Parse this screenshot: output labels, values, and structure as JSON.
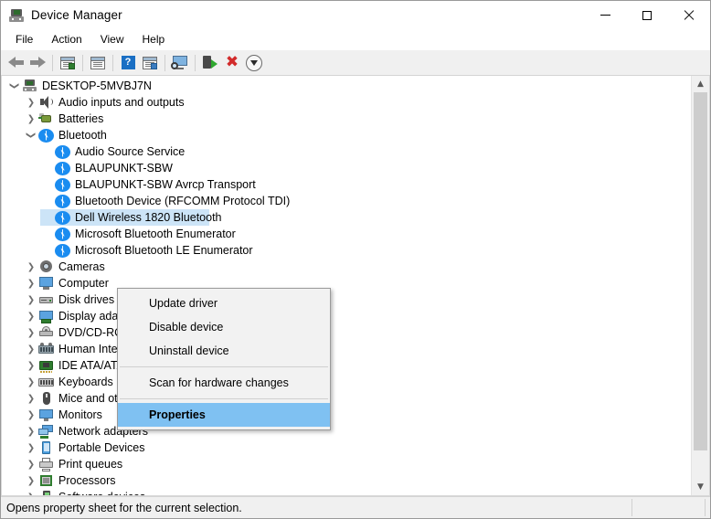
{
  "window": {
    "title": "Device Manager",
    "title_icon": "computer-icon",
    "buttons": {
      "minimize": "minimize-button",
      "maximize": "maximize-button",
      "close": "close-button"
    }
  },
  "menubar": [
    {
      "label": "File"
    },
    {
      "label": "Action"
    },
    {
      "label": "View"
    },
    {
      "label": "Help"
    }
  ],
  "toolbar": [
    {
      "name": "back-icon",
      "type": "arrow-left"
    },
    {
      "name": "forward-icon",
      "type": "arrow-right"
    },
    {
      "name": "separator-1",
      "type": "sep"
    },
    {
      "name": "show-hide-console-tree-icon",
      "type": "win-green"
    },
    {
      "name": "separator-2",
      "type": "sep"
    },
    {
      "name": "properties-icon",
      "type": "win-plain"
    },
    {
      "name": "separator-3",
      "type": "sep"
    },
    {
      "name": "help-icon",
      "type": "help"
    },
    {
      "name": "update-driver-icon",
      "type": "win-blue"
    },
    {
      "name": "separator-4",
      "type": "sep"
    },
    {
      "name": "scan-for-hardware-changes-icon",
      "type": "monitor"
    },
    {
      "name": "separator-5",
      "type": "sep"
    },
    {
      "name": "enable-device-icon",
      "type": "scan"
    },
    {
      "name": "uninstall-device-icon",
      "type": "x"
    },
    {
      "name": "update-driver-download-icon",
      "type": "down"
    }
  ],
  "tree": [
    {
      "label": "DESKTOP-5MVBJ7N",
      "indent": 0,
      "twisty": "expanded",
      "icon": "computer-icon"
    },
    {
      "label": "Audio inputs and outputs",
      "indent": 1,
      "twisty": "collapsed",
      "icon": "speaker-icon"
    },
    {
      "label": "Batteries",
      "indent": 1,
      "twisty": "collapsed",
      "icon": "battery-icon"
    },
    {
      "label": "Bluetooth",
      "indent": 1,
      "twisty": "expanded",
      "icon": "bluetooth-icon"
    },
    {
      "label": "Audio Source Service",
      "indent": 2,
      "twisty": "none",
      "icon": "bluetooth-icon"
    },
    {
      "label": "BLAUPUNKT-SBW",
      "indent": 2,
      "twisty": "none",
      "icon": "bluetooth-icon"
    },
    {
      "label": "BLAUPUNKT-SBW Avrcp Transport",
      "indent": 2,
      "twisty": "none",
      "icon": "bluetooth-icon"
    },
    {
      "label": "Bluetooth Device (RFCOMM Protocol TDI)",
      "indent": 2,
      "twisty": "none",
      "icon": "bluetooth-icon"
    },
    {
      "label": "Dell Wireless 1820 Bluetooth",
      "indent": 2,
      "twisty": "none",
      "icon": "bluetooth-icon",
      "selected": true,
      "clipped_width": 185
    },
    {
      "label": "Microsoft Bluetooth Enumerator",
      "indent": 2,
      "twisty": "none",
      "icon": "bluetooth-icon"
    },
    {
      "label": "Microsoft Bluetooth LE Enumerator",
      "indent": 2,
      "twisty": "none",
      "icon": "bluetooth-icon"
    },
    {
      "label": "Cameras",
      "indent": 1,
      "twisty": "collapsed",
      "icon": "camera-icon"
    },
    {
      "label": "Computer",
      "indent": 1,
      "twisty": "collapsed",
      "icon": "computer-monitor-icon"
    },
    {
      "label": "Disk drives",
      "indent": 1,
      "twisty": "collapsed",
      "icon": "disk-drive-icon"
    },
    {
      "label": "Display adapters",
      "indent": 1,
      "twisty": "collapsed",
      "icon": "display-adapter-icon"
    },
    {
      "label": "DVD/CD-ROM drives",
      "indent": 1,
      "twisty": "collapsed",
      "icon": "dvd-drive-icon"
    },
    {
      "label": "Human Interface Devices",
      "indent": 1,
      "twisty": "collapsed",
      "icon": "hid-icon"
    },
    {
      "label": "IDE ATA/ATAPI controllers",
      "indent": 1,
      "twisty": "collapsed",
      "icon": "ide-controller-icon"
    },
    {
      "label": "Keyboards",
      "indent": 1,
      "twisty": "collapsed",
      "icon": "keyboard-icon"
    },
    {
      "label": "Mice and other pointing devices",
      "indent": 1,
      "twisty": "collapsed",
      "icon": "mouse-icon"
    },
    {
      "label": "Monitors",
      "indent": 1,
      "twisty": "collapsed",
      "icon": "monitor-icon"
    },
    {
      "label": "Network adapters",
      "indent": 1,
      "twisty": "collapsed",
      "icon": "network-adapter-icon"
    },
    {
      "label": "Portable Devices",
      "indent": 1,
      "twisty": "collapsed",
      "icon": "portable-device-icon"
    },
    {
      "label": "Print queues",
      "indent": 1,
      "twisty": "collapsed",
      "icon": "printer-icon"
    },
    {
      "label": "Processors",
      "indent": 1,
      "twisty": "collapsed",
      "icon": "processor-icon"
    },
    {
      "label": "Software devices",
      "indent": 1,
      "twisty": "collapsed",
      "icon": "software-device-icon"
    }
  ],
  "context_menu": {
    "items": [
      {
        "label": "Update driver",
        "type": "item"
      },
      {
        "label": "Disable device",
        "type": "item"
      },
      {
        "label": "Uninstall device",
        "type": "item"
      },
      {
        "label": "",
        "type": "separator"
      },
      {
        "label": "Scan for hardware changes",
        "type": "item"
      },
      {
        "label": "",
        "type": "separator"
      },
      {
        "label": "Properties",
        "type": "item",
        "highlighted": true
      }
    ]
  },
  "statusbar": {
    "text": "Opens property sheet for the current selection."
  },
  "scrollbar": {
    "up_arrow": "scroll-up-arrow",
    "down_arrow": "scroll-down-arrow"
  },
  "colors": {
    "selection_blue": "#cce4f7",
    "menu_highlight_blue": "#7fc1f2",
    "bluetooth_blue": "#1a8cf0",
    "window_bg": "#f0f0f0"
  }
}
